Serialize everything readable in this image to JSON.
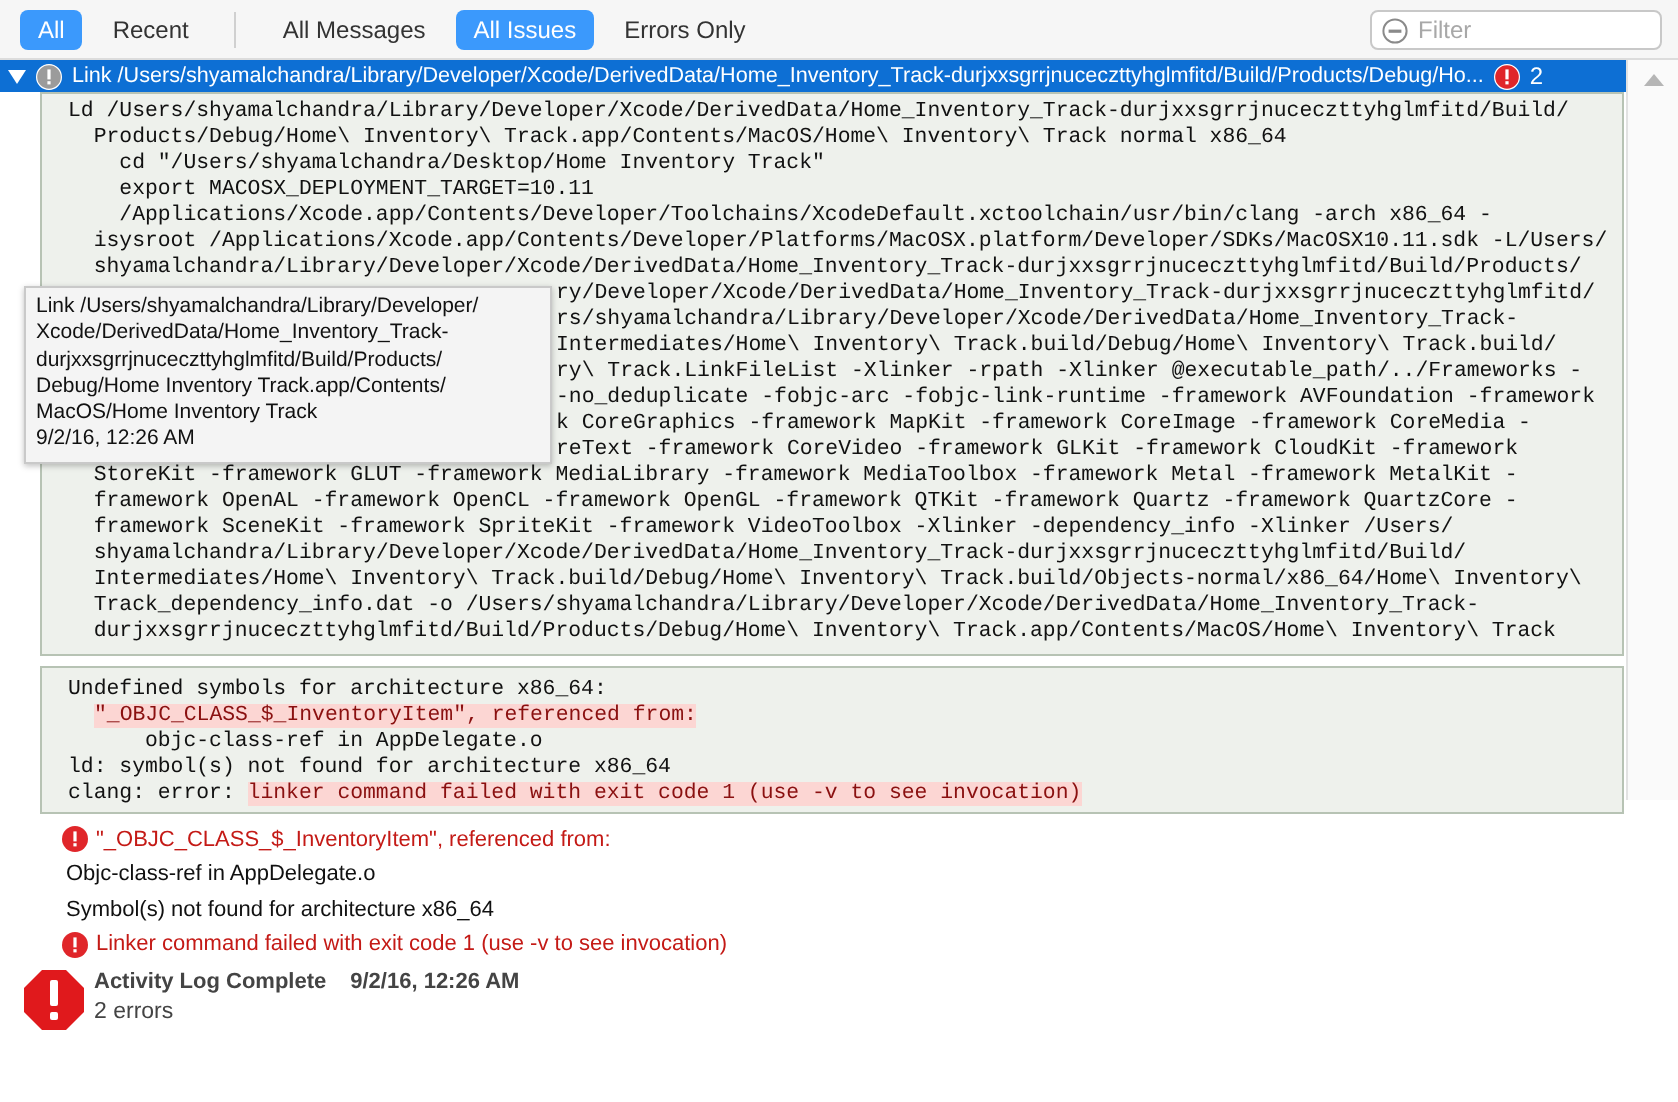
{
  "scope_tabs": [
    {
      "label": "All",
      "selected": true
    },
    {
      "label": "Recent",
      "selected": false
    }
  ],
  "filter_tabs": [
    {
      "label": "All Messages",
      "selected": false
    },
    {
      "label": "All Issues",
      "selected": true
    },
    {
      "label": "Errors Only",
      "selected": false
    }
  ],
  "filter_field": {
    "placeholder": "Filter"
  },
  "log_entry": {
    "expanded": true,
    "selected": true,
    "title": "Link /Users/shyamalchandra/Library/Developer/Xcode/DerivedData/Home_Inventory_Track-durjxxsgrrjnuceczttyhglmfitd/Build/Products/Debug/Ho...",
    "error_count": "2",
    "command_lines": [
      {
        "text": "Ld /Users/shyamalchandra/Library/Developer/Xcode/DerivedData/Home_Inventory_Track-durjxxsgrrjnuceczttyhglmfitd/Build/",
        "partial": false
      },
      {
        "text": "  Products/Debug/Home\\ Inventory\\ Track.app/Contents/MacOS/Home\\ Inventory\\ Track normal x86_64",
        "partial": false
      },
      {
        "text": "    cd \"/Users/shyamalchandra/Desktop/Home Inventory Track\"",
        "partial": false
      },
      {
        "text": "    export MACOSX_DEPLOYMENT_TARGET=10.11",
        "partial": false
      },
      {
        "text": "    /Applications/Xcode.app/Contents/Developer/Toolchains/XcodeDefault.xctoolchain/usr/bin/clang -arch x86_64 -",
        "partial": false
      },
      {
        "text": "  isysroot /Applications/Xcode.app/Contents/Developer/Platforms/MacOSX.platform/Developer/SDKs/MacOSX10.11.sdk -L/Users/",
        "partial": false
      },
      {
        "text": "  shyamalchandra/Library/Developer/Xcode/DerivedData/Home_Inventory_Track-durjxxsgrrjnuceczttyhglmfitd/Build/Products/",
        "partial": false
      },
      {
        "text": "ry/Developer/Xcode/DerivedData/Home_Inventory_Track-durjxxsgrrjnuceczttyhglmfitd/",
        "partial": true
      },
      {
        "text": "rs/shyamalchandra/Library/Developer/Xcode/DerivedData/Home_Inventory_Track-",
        "partial": true
      },
      {
        "text": "Intermediates/Home\\ Inventory\\ Track.build/Debug/Home\\ Inventory\\ Track.build/",
        "partial": true
      },
      {
        "text": "ry\\ Track.LinkFileList -Xlinker -rpath -Xlinker @executable_path/../Frameworks -",
        "partial": true
      },
      {
        "text": "-no_deduplicate -fobjc-arc -fobjc-link-runtime -framework AVFoundation -framework",
        "partial": true
      },
      {
        "text": "k CoreGraphics -framework MapKit -framework CoreImage -framework CoreMedia -",
        "partial": true
      },
      {
        "text": "reText -framework CoreVideo -framework GLKit -framework CloudKit -framework",
        "partial": true
      },
      {
        "text": "  StoreKit -framework GLUT -framework MediaLibrary -framework MediaToolbox -framework Metal -framework MetalKit -",
        "partial": false
      },
      {
        "text": "  framework OpenAL -framework OpenCL -framework OpenGL -framework QTKit -framework Quartz -framework QuartzCore -",
        "partial": false
      },
      {
        "text": "  framework SceneKit -framework SpriteKit -framework VideoToolbox -Xlinker -dependency_info -Xlinker /Users/",
        "partial": false
      },
      {
        "text": "  shyamalchandra/Library/Developer/Xcode/DerivedData/Home_Inventory_Track-durjxxsgrrjnuceczttyhglmfitd/Build/",
        "partial": false
      },
      {
        "text": "  Intermediates/Home\\ Inventory\\ Track.build/Debug/Home\\ Inventory\\ Track.build/Objects-normal/x86_64/Home\\ Inventory\\",
        "partial": false
      },
      {
        "text": "  Track_dependency_info.dat -o /Users/shyamalchandra/Library/Developer/Xcode/DerivedData/Home_Inventory_Track-",
        "partial": false
      },
      {
        "text": "  durjxxsgrrjnuceczttyhglmfitd/Build/Products/Debug/Home\\ Inventory\\ Track.app/Contents/MacOS/Home\\ Inventory\\ Track",
        "partial": false
      }
    ],
    "error_output": [
      {
        "indented": false,
        "segments": [
          {
            "text": "Undefined symbols for architecture x86_64:",
            "highlight": false
          }
        ]
      },
      {
        "indented": true,
        "segments": [
          {
            "text": "\"_OBJC_CLASS_$_InventoryItem\", referenced from:",
            "highlight": true
          }
        ]
      },
      {
        "indented": false,
        "segments": [
          {
            "text": "      objc-class-ref in AppDelegate.o",
            "highlight": false
          }
        ]
      },
      {
        "indented": false,
        "segments": [
          {
            "text": "ld: symbol(s) not found for architecture x86_64",
            "highlight": false
          }
        ]
      },
      {
        "indented": false,
        "segments": [
          {
            "text": "clang: error: ",
            "highlight": false
          },
          {
            "text": "linker command failed with exit code 1 (use -v to see invocation)",
            "highlight": true
          }
        ]
      }
    ]
  },
  "tooltip": {
    "path_lines": [
      "Link /Users/shyamalchandra/Library/Developer/",
      "Xcode/DerivedData/Home_Inventory_Track-",
      "durjxxsgrrjnuceczttyhglmfitd/Build/Products/",
      "Debug/Home Inventory Track.app/Contents/",
      "MacOS/Home Inventory Track"
    ],
    "time": "9/2/16, 12:26 AM"
  },
  "issues": [
    {
      "kind": "error",
      "text": "\"_OBJC_CLASS_$_InventoryItem\", referenced from:"
    },
    {
      "kind": "note",
      "text": "Objc-class-ref in AppDelegate.o"
    },
    {
      "kind": "note",
      "text": "Symbol(s) not found for architecture x86_64"
    },
    {
      "kind": "error",
      "text": "Linker command failed with exit code 1 (use -v to see invocation)"
    }
  ],
  "summary": {
    "title": "Activity Log Complete",
    "time": "9/2/16, 12:26 AM",
    "detail": "2 errors"
  }
}
